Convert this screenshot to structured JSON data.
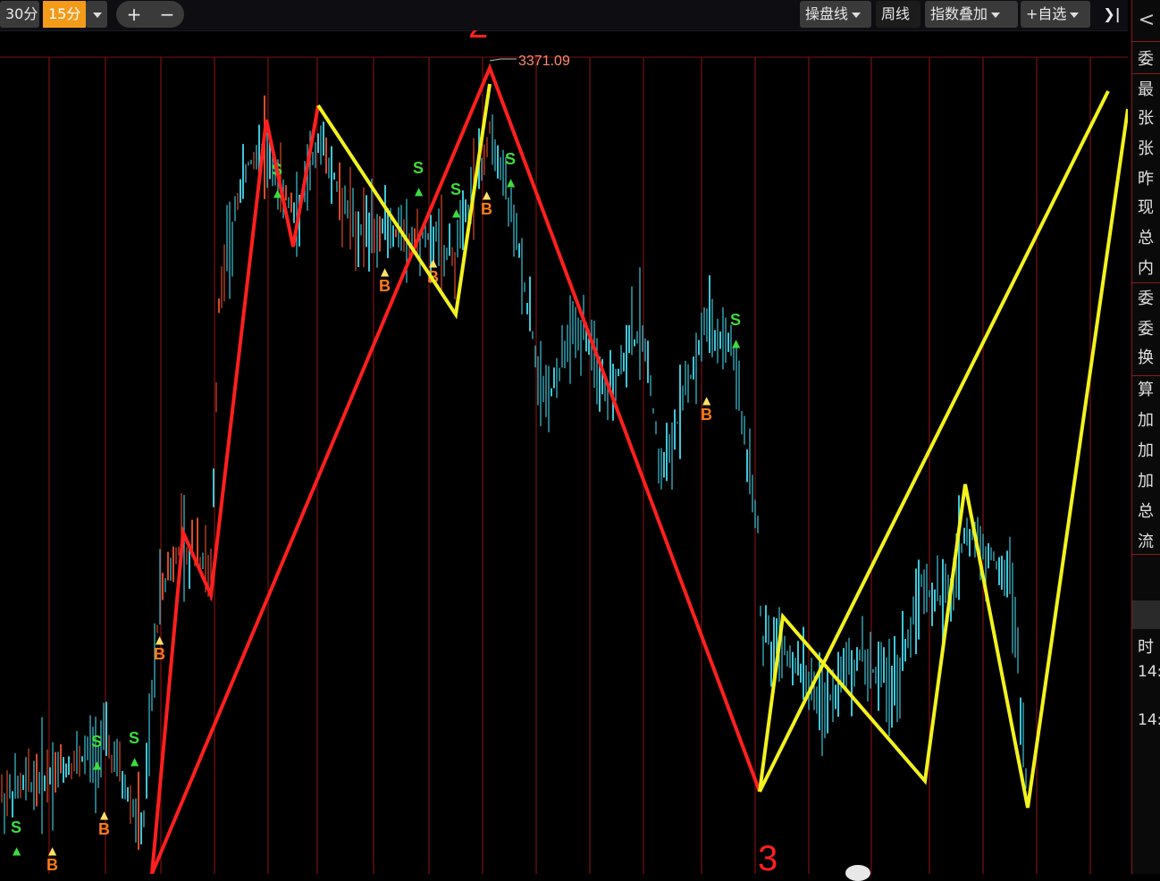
{
  "toolbar": {
    "period_30": "30分",
    "period_15": "15分",
    "zoom_in": "+",
    "zoom_out": "−",
    "btn_trade": "操盘线",
    "btn_week": "周线",
    "btn_index_overlay": "指数叠加",
    "btn_watchlist": "+自选",
    "btn_collapse": "❯|"
  },
  "annotations": {
    "peak_label": "2",
    "trough_label": "3",
    "peak_price": "3371.09"
  },
  "signals": [
    {
      "text": "S",
      "color": "#3ddc3d"
    },
    {
      "text": "B",
      "color": "#ff7a1a"
    }
  ],
  "sidebar": {
    "back": "<",
    "items": [
      "委",
      "最",
      "张",
      "张",
      "昨",
      "现",
      "总",
      "内",
      "委",
      "委",
      "换",
      "算",
      "加",
      "加",
      "加",
      "总",
      "流"
    ],
    "time_header": "时",
    "times": [
      "14:",
      "14:"
    ]
  },
  "colors": {
    "background": "#000000",
    "candle": "#3ec6d8",
    "red_line": "#ff1f1f",
    "yellow_line": "#f2f21e",
    "grid": "#7a1010",
    "accent_orange": "#f59b1a"
  }
}
